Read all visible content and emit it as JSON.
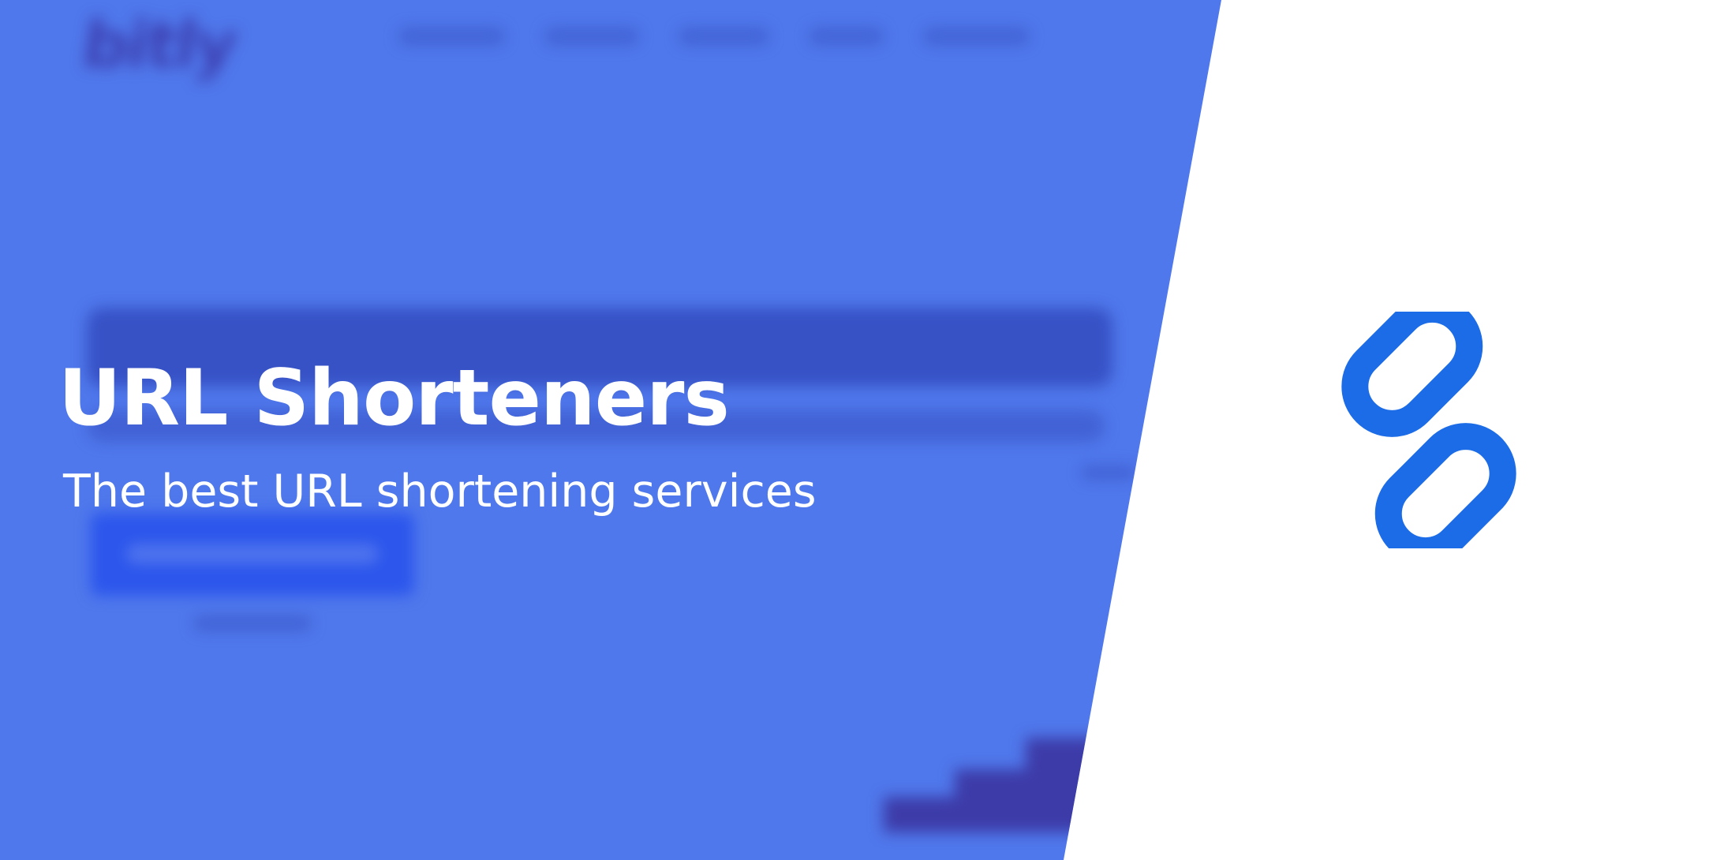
{
  "banner": {
    "title": "URL Shorteners",
    "subtitle": "The best URL shortening services",
    "icon": "link-chain-icon"
  },
  "colors": {
    "panel_blue": "#4f78ec",
    "icon_blue": "#1b6ce6",
    "background": "#ffffff",
    "text": "#ffffff"
  }
}
